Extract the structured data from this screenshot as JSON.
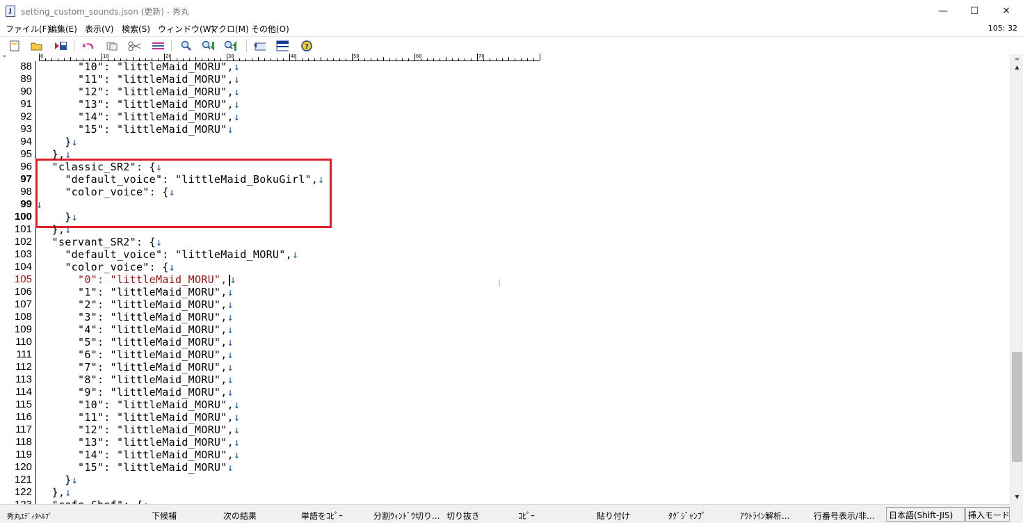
{
  "window": {
    "title": "setting_custom_sounds.json (更新) - 秀丸",
    "app_icon_glyph": "J",
    "minimize": "—",
    "maximize": "☐",
    "close": "✕"
  },
  "menu": {
    "items": [
      "ファイル(F)",
      "編集(E)",
      "表示(V)",
      "検索(S)",
      "ウィンドウ(W)",
      "マクロ(M)",
      "その他(O)"
    ],
    "cursor_position": "105: 32"
  },
  "toolbar": {
    "icons": [
      "new-file-icon",
      "open-folder-icon",
      "save-icon",
      "undo-icon",
      "copy-icon",
      "cut-icon",
      "paste-icon",
      "search-icon",
      "search-down-icon",
      "search-up-icon",
      "window-icon",
      "split-window-icon",
      "help-icon"
    ]
  },
  "ruler": {
    "chevron": "»",
    "labels": [
      "0",
      "10",
      "20",
      "30",
      "40",
      "50",
      "60",
      "70"
    ]
  },
  "editor": {
    "lines": [
      {
        "n": "88",
        "code": "      \"10\": \"littleMaid_MORU\",",
        "eol": "↓"
      },
      {
        "n": "89",
        "code": "      \"11\": \"littleMaid_MORU\",",
        "eol": "↓"
      },
      {
        "n": "90",
        "code": "      \"12\": \"littleMaid_MORU\",",
        "eol": "↓"
      },
      {
        "n": "91",
        "code": "      \"13\": \"littleMaid_MORU\",",
        "eol": "↓"
      },
      {
        "n": "92",
        "code": "      \"14\": \"littleMaid_MORU\",",
        "eol": "↓"
      },
      {
        "n": "93",
        "code": "      \"15\": \"littleMaid_MORU\"",
        "eol": "↓"
      },
      {
        "n": "94",
        "code": "    }",
        "eol": "↓"
      },
      {
        "n": "95",
        "code": "  },",
        "eol": "↓"
      },
      {
        "n": "96",
        "code": "  \"classic_SR2\": {",
        "eol": "↓"
      },
      {
        "n": "97",
        "code": "    \"default_voice\": \"littleMaid_BokuGirl\",",
        "eol": "↓",
        "bold": true
      },
      {
        "n": "98",
        "code": "    \"color_voice\": {",
        "eol": "↓"
      },
      {
        "n": "99",
        "code": "",
        "eol": "↓",
        "bold": true
      },
      {
        "n": "100",
        "code": "    }",
        "eol": "↓",
        "bold": true
      },
      {
        "n": "101",
        "code": "  },",
        "eol": "↓"
      },
      {
        "n": "102",
        "code": "  \"servant_SR2\": {",
        "eol": "↓"
      },
      {
        "n": "103",
        "code": "    \"default_voice\": \"littleMaid_MORU\",",
        "eol": "↓"
      },
      {
        "n": "104",
        "code": "    \"color_voice\": {",
        "eol": "↓"
      },
      {
        "n": "105",
        "code": "      \"0\": \"littleMaid_MORU\",",
        "eol": "↓",
        "red": true,
        "caret": true
      },
      {
        "n": "106",
        "code": "      \"1\": \"littleMaid_MORU\",",
        "eol": "↓"
      },
      {
        "n": "107",
        "code": "      \"2\": \"littleMaid_MORU\",",
        "eol": "↓"
      },
      {
        "n": "108",
        "code": "      \"3\": \"littleMaid_MORU\",",
        "eol": "↓"
      },
      {
        "n": "109",
        "code": "      \"4\": \"littleMaid_MORU\",",
        "eol": "↓"
      },
      {
        "n": "110",
        "code": "      \"5\": \"littleMaid_MORU\",",
        "eol": "↓"
      },
      {
        "n": "111",
        "code": "      \"6\": \"littleMaid_MORU\",",
        "eol": "↓"
      },
      {
        "n": "112",
        "code": "      \"7\": \"littleMaid_MORU\",",
        "eol": "↓"
      },
      {
        "n": "113",
        "code": "      \"8\": \"littleMaid_MORU\",",
        "eol": "↓"
      },
      {
        "n": "114",
        "code": "      \"9\": \"littleMaid_MORU\",",
        "eol": "↓"
      },
      {
        "n": "115",
        "code": "      \"10\": \"littleMaid_MORU\",",
        "eol": "↓"
      },
      {
        "n": "116",
        "code": "      \"11\": \"littleMaid_MORU\",",
        "eol": "↓"
      },
      {
        "n": "117",
        "code": "      \"12\": \"littleMaid_MORU\",",
        "eol": "↓"
      },
      {
        "n": "118",
        "code": "      \"13\": \"littleMaid_MORU\",",
        "eol": "↓"
      },
      {
        "n": "119",
        "code": "      \"14\": \"littleMaid_MORU\",",
        "eol": "↓"
      },
      {
        "n": "120",
        "code": "      \"15\": \"littleMaid_MORU\"",
        "eol": "↓"
      },
      {
        "n": "121",
        "code": "    }",
        "eol": "↓"
      },
      {
        "n": "122",
        "code": "  },",
        "eol": "↓"
      },
      {
        "n": "123",
        "code": "  \"cafe_Chef\": {",
        "eol": "↓"
      }
    ],
    "highlight_color": "#e0202a",
    "current_line_color": "#a01010",
    "eol_color": "#1a5aa0"
  },
  "statusbar": {
    "function_keys": [
      "秀丸ｴﾃﾞｨﾀﾍﾙﾌﾟ",
      "下候補",
      "次の結果",
      "単語をｺﾋﾟｰ",
      "分割ｳｨﾝﾄﾞｳ切り...",
      "切り抜き",
      "ｺﾋﾟｰ",
      "貼り付け",
      "ﾀｸﾞｼﾞｬﾝﾌﾟ",
      "ｱｳﾄﾗｲﾝ解析...",
      "行番号表示/非..."
    ],
    "encoding": "日本語(Shift-JIS)",
    "mode": "挿入モード"
  }
}
